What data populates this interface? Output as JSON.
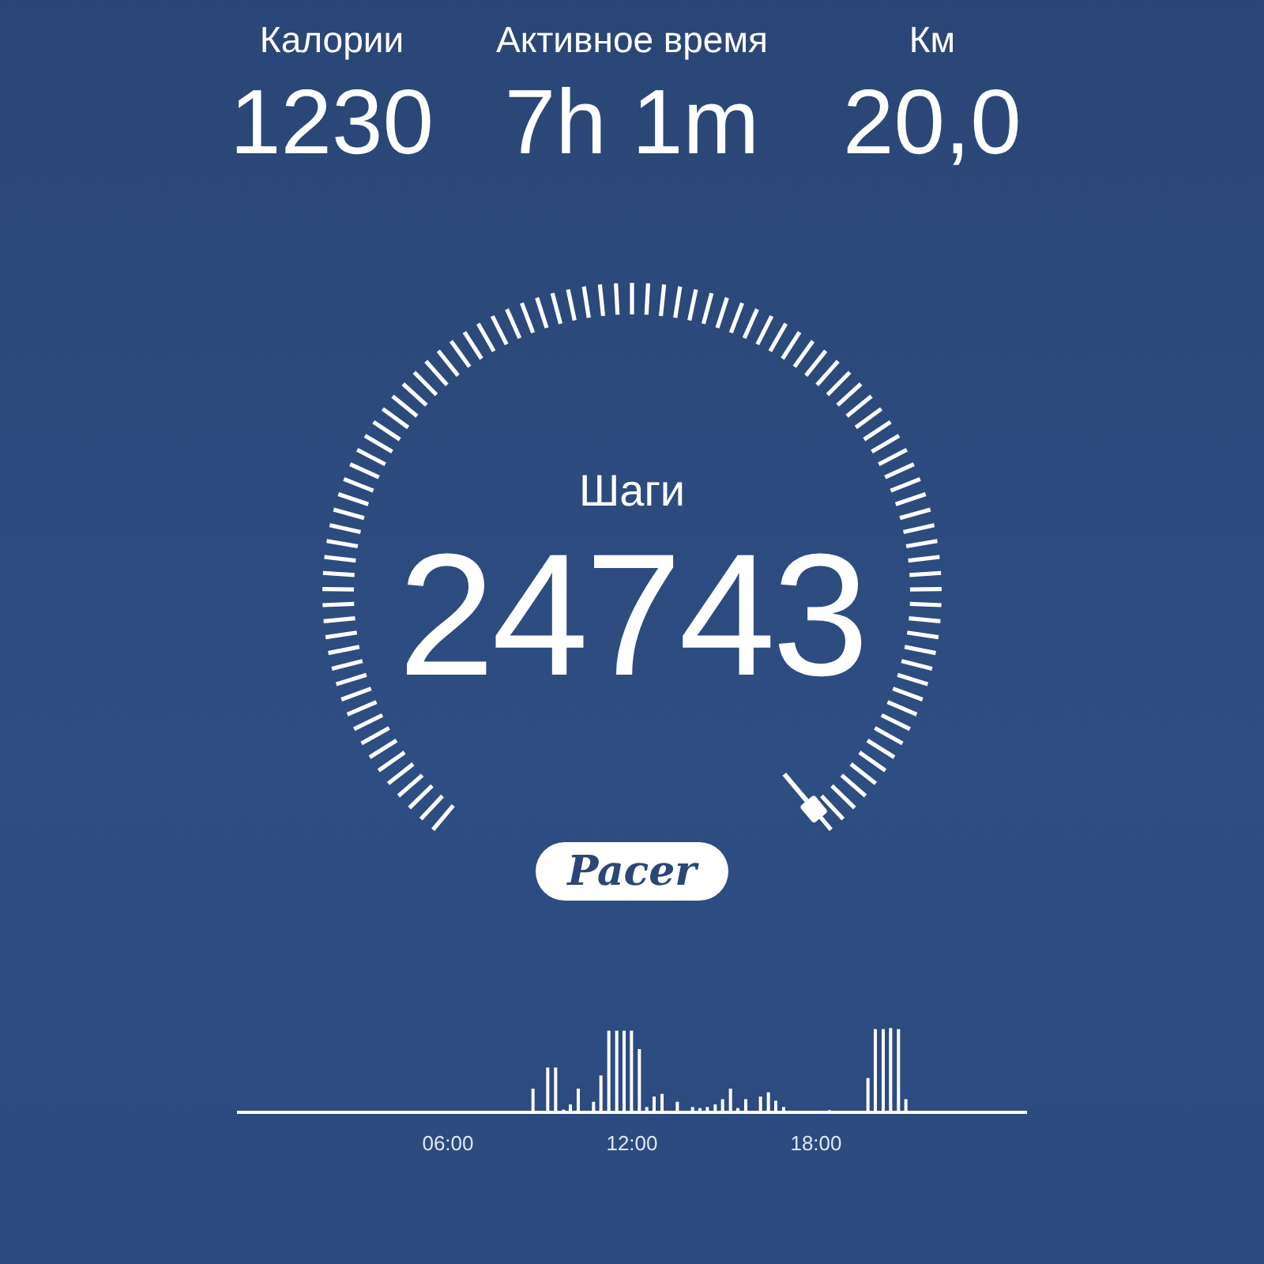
{
  "stats": [
    {
      "label": "Калории",
      "value": "1230"
    },
    {
      "label": "Активное время",
      "value": "7h 1m"
    },
    {
      "label": "Км",
      "value": "20,0"
    }
  ],
  "gauge": {
    "label": "Шаги",
    "value": "24743"
  },
  "badge": {
    "text": "Pacer"
  },
  "activity": {
    "xlabels": [
      "06:00",
      "12:00",
      "18:00"
    ]
  }
}
